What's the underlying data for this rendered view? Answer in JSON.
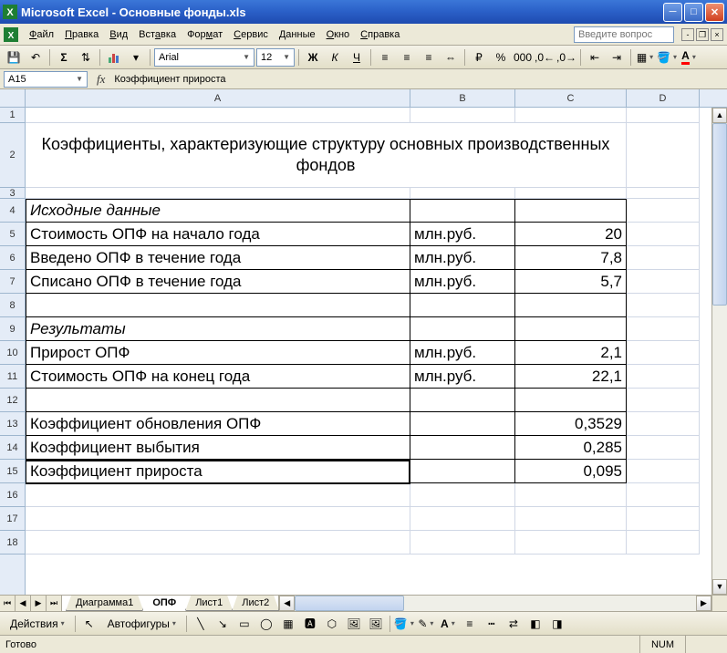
{
  "titlebar": {
    "text": "Microsoft Excel - Основные фонды.xls"
  },
  "menu": {
    "file": "Файл",
    "edit": "Правка",
    "view": "Вид",
    "insert": "Вставка",
    "format": "Формат",
    "service": "Сервис",
    "data": "Данные",
    "window": "Окно",
    "help": "Справка",
    "searchPlaceholder": "Введите вопрос"
  },
  "toolbar": {
    "fontName": "Arial",
    "fontSize": "12"
  },
  "formula": {
    "nameBox": "A15",
    "fxLabel": "fx",
    "content": "Коэффициент прироста"
  },
  "columns": [
    "A",
    "B",
    "C",
    "D"
  ],
  "rows": [
    "1",
    "2",
    "3",
    "4",
    "5",
    "6",
    "7",
    "8",
    "9",
    "10",
    "11",
    "12",
    "13",
    "14",
    "15",
    "16",
    "17",
    "18"
  ],
  "cells": {
    "title": "Коэффициенты, характеризующие структуру основных производственных фондов",
    "r4a": "Исходные данные",
    "r5a": "Стоимость ОПФ на начало года",
    "r5b": "млн.руб.",
    "r5c": "20",
    "r6a": "Введено ОПФ в течение года",
    "r6b": "млн.руб.",
    "r6c": "7,8",
    "r7a": "Списано ОПФ в течение года",
    "r7b": "млн.руб.",
    "r7c": "5,7",
    "r9a": "Результаты",
    "r10a": "Прирост ОПФ",
    "r10b": "млн.руб.",
    "r10c": "2,1",
    "r11a": "Стоимость ОПФ на конец года",
    "r11b": "млн.руб.",
    "r11c": "22,1",
    "r13a": "Коэффициент обновления ОПФ",
    "r13c": "0,3529",
    "r14a": "Коэффициент выбытия",
    "r14c": "0,285",
    "r15a": "Коэффициент прироста",
    "r15c": "0,095"
  },
  "tabs": {
    "t1": "Диаграмма1",
    "t2": "ОПФ",
    "t3": "Лист1",
    "t4": "Лист2"
  },
  "drawbar": {
    "actions": "Действия",
    "autoshapes": "Автофигуры"
  },
  "status": {
    "ready": "Готово",
    "num": "NUM"
  }
}
